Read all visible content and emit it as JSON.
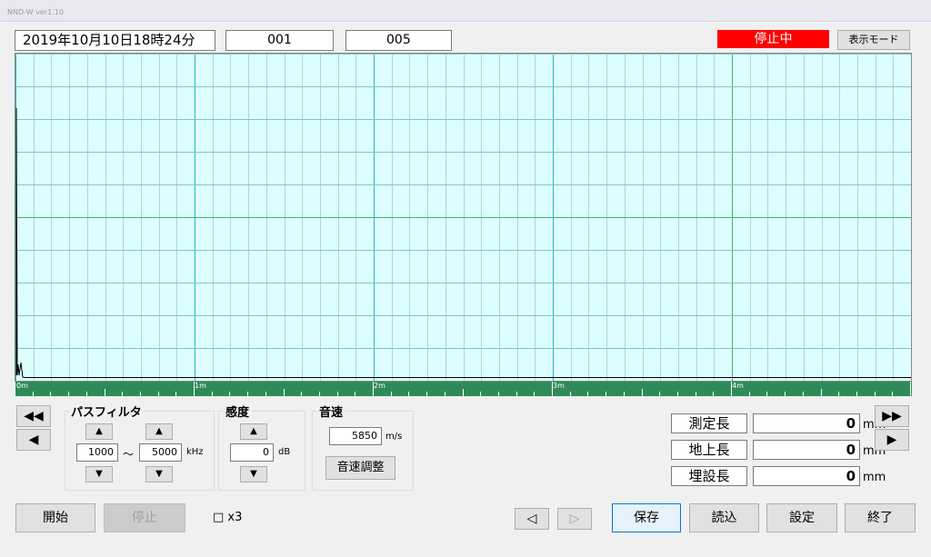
{
  "app": {
    "title": "NND-W ver1.10"
  },
  "header": {
    "datetime": "2019年10月10日18時24分",
    "field1": "001",
    "field2": "005",
    "status": "停止中",
    "mode_button": "表示モード"
  },
  "graph": {
    "background_color": "#ddfefe",
    "trace_color": "#000000",
    "scale_color": "#2e8b57",
    "scale_labels": [
      "0m",
      "1m",
      "2m",
      "3m",
      "4m"
    ]
  },
  "nav": {
    "first": "◀◀",
    "prev": "◀",
    "last": "▶▶",
    "next": "▶"
  },
  "bandpass": {
    "title": "パスフィルタ",
    "low": "1000",
    "tilde": "〜",
    "high": "5000",
    "unit": "kHz",
    "up": "▲",
    "down": "▼"
  },
  "sensitivity": {
    "title": "感度",
    "value": "0",
    "unit": "dB",
    "up": "▲",
    "down": "▼"
  },
  "sound_speed": {
    "title": "音速",
    "value": "5850",
    "unit": "m/s",
    "adjust_button": "音速調整"
  },
  "measurements": [
    {
      "label": "測定長",
      "value": "0",
      "unit": "mm"
    },
    {
      "label": "地上長",
      "value": "0",
      "unit": "mm"
    },
    {
      "label": "埋設長",
      "value": "0",
      "unit": "mm"
    }
  ],
  "bottom": {
    "start": "開始",
    "stop": "停止",
    "x3_label": "□ x3",
    "page_prev": "◁",
    "page_next": "▷",
    "save": "保存",
    "load": "読込",
    "settings": "設定",
    "exit": "終了"
  }
}
